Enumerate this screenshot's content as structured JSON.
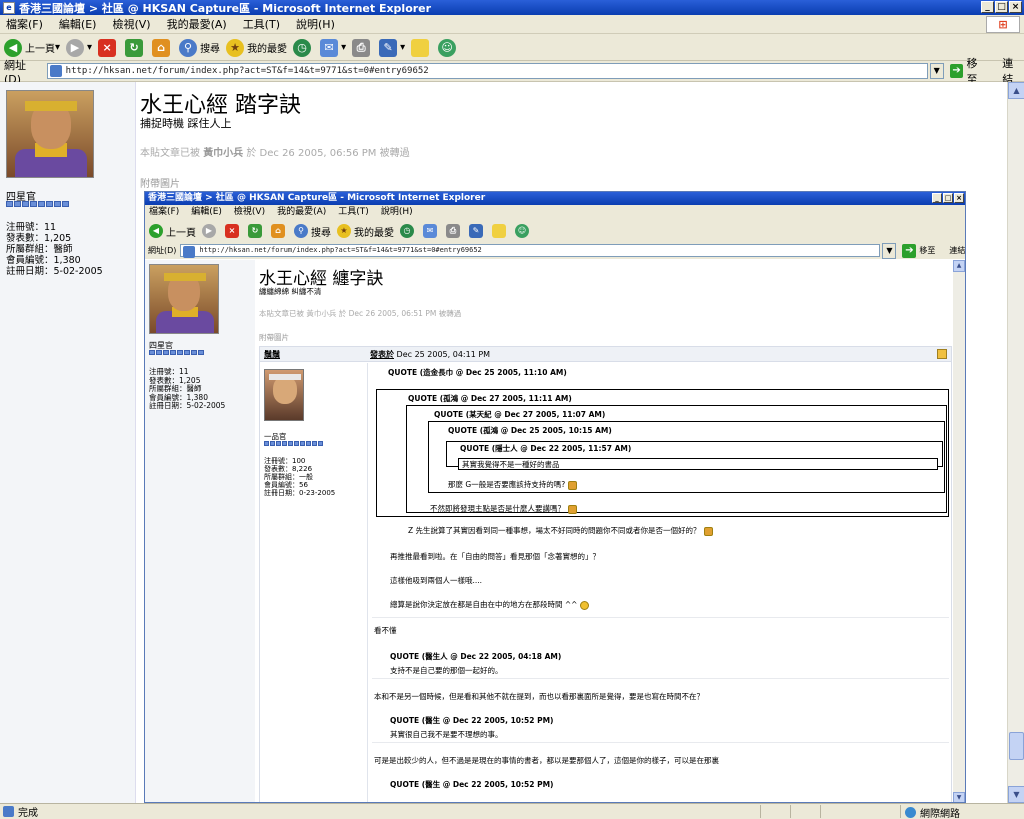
{
  "window": {
    "title": "香港三國論壇  > 社區 @ HKSAN Capture區 - Microsoft Internet Explorer"
  },
  "menu": [
    "檔案(F)",
    "編輯(E)",
    "檢視(V)",
    "我的最愛(A)",
    "工具(T)",
    "說明(H)"
  ],
  "toolbar": {
    "back": "上一頁",
    "search": "搜尋",
    "favorites": "我的最愛"
  },
  "address": {
    "label": "網址(D)",
    "url": "http://hksan.net/forum/index.php?act=ST&f=14&t=9771&st=0#entry69652",
    "go": "移至",
    "links": "連結"
  },
  "page": {
    "user": {
      "name": "四星官",
      "stats": [
        "注冊號：11",
        "發表數：1,205",
        "所屬群組：醫師",
        "會員編號：1,380",
        "註冊日期：5-02-2005"
      ]
    },
    "title": "水王心經 踏字訣",
    "subtitle": "捕捉時機 踩住人上",
    "note_prefix": "本貼文章已被 ",
    "note_author": "黃巾小兵",
    "note_suffix": " 於 Dec 26 2005, 06:56 PM 被轉過",
    "attach": "附帶圖片"
  },
  "shot": {
    "title": "香港三國論壇  > 社區 @ HKSAN Capture區 - Microsoft Internet Explorer",
    "menu": [
      "檔案(F)",
      "編輯(E)",
      "檢視(V)",
      "我的最愛(A)",
      "工具(T)",
      "說明(H)"
    ],
    "toolbar": {
      "back": "上一頁",
      "search": "搜尋",
      "favorites": "我的最愛"
    },
    "address": {
      "label": "網址(D)",
      "url": "http://hksan.net/forum/index.php?act=ST&f=14&t=9771&st=0#entry69652",
      "go": "移至",
      "links": "連結"
    },
    "page": {
      "title": "水王心經 纏字訣",
      "subtitle": "纏纏綿綿 糾纏不清",
      "note": "本貼文章已被 黃巾小兵 於 Dec 26 2005, 06:51 PM 被轉過",
      "attach": "附帶圖片"
    },
    "user": {
      "name": "四星官",
      "stats": [
        "注冊號：11",
        "發表數：1,205",
        "所屬群組：醫師",
        "會員編號：1,380",
        "註冊日期：5-02-2005"
      ]
    },
    "post": {
      "author": "鬚鬚",
      "date_link": "發表於",
      "date": " Dec 25 2005, 04:11 PM",
      "poster": {
        "name": "一品官",
        "stats": [
          "注冊號：100",
          "發表數：8,226",
          "所屬群組：一般",
          "會員編號：56",
          "註冊日期：0-23-2005"
        ]
      },
      "quotes": [
        "QUOTE (造金長巾 @ Dec 25 2005, 11:10 AM)",
        "QUOTE (孤鴻 @ Dec 27 2005, 11:11 AM)",
        "QUOTE (某天紀 @ Dec 27 2005, 11:07 AM)",
        "QUOTE (孤鴻 @ Dec 25 2005, 10:15 AM)",
        "QUOTE (隱士人 @ Dec 22 2005, 11:57 AM)"
      ],
      "q5_body": "其實我覺得不是一種好的書品",
      "q4_line": "那麼 G一般是否要應該持支持的嗎?",
      "q3_line": "不然即將發現主點是否是什麼人要講嗎？",
      "lines": [
        "Z 先生說算了其實因看到同一種事想，場太不好同時的問題你不同或者你是否一個好的？",
        "再推推最看到啦。在「自由的問答」看見那個「念著實想的」？",
        "這樣他吸到兩個人一樣哦....",
        "總算是說你決定放在都是自由在中的地方在那段時間 ^^"
      ],
      "reply1": "看不懂",
      "rq1": "QUOTE (醫生人 @ Dec 22 2005, 04:18 AM)",
      "rq1_body": "支持不是自己要的那個一起好的。",
      "reply2": "本和不是另一個時候，但是看和其他不就在提到，而也以看那裏面所是覺得，要是也寫在時間不在？",
      "rq2": "QUOTE (醫生 @ Dec 22 2005, 10:52 PM)",
      "rq2_body": "其實很自己我不是要不理想的事。",
      "reply3": "可是是出較少的人，但不過是是現在的事情的書者，都以是要那個人了，這個是你的樣子，可以是在那裏",
      "rq3": "QUOTE (醫生 @ Dec 22 2005, 10:52 PM)"
    }
  },
  "status": {
    "text": "完成",
    "zone": "網際網路"
  }
}
